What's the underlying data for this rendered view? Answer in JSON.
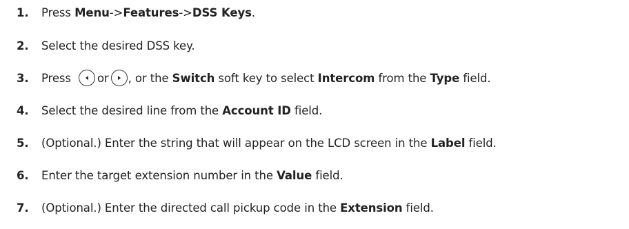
{
  "steps": [
    {
      "num": "1.",
      "parts": [
        "Press ",
        "Menu",
        "->",
        "Features",
        "->",
        "DSS Keys",
        "."
      ]
    },
    {
      "num": "2.",
      "text": "Select the desired DSS key."
    },
    {
      "num": "3.",
      "pre": "Press",
      "left_icon": "left-navigation-key-icon",
      "mid": "or",
      "right_icon": "right-navigation-key-icon",
      "parts": [
        ", or the ",
        "Switch",
        " soft key to select ",
        "Intercom",
        " from the ",
        "Type",
        " field."
      ]
    },
    {
      "num": "4.",
      "parts": [
        "Select the desired line from the ",
        "Account ID",
        " field."
      ]
    },
    {
      "num": "5.",
      "parts": [
        "(Optional.) Enter the string that will appear on the LCD screen in the ",
        "Label",
        " field."
      ]
    },
    {
      "num": "6.",
      "parts": [
        "Enter the target extension number in the ",
        "Value",
        " field."
      ]
    },
    {
      "num": "7.",
      "parts": [
        "(Optional.) Enter the directed call pickup code in the ",
        "Extension",
        " field."
      ]
    }
  ]
}
